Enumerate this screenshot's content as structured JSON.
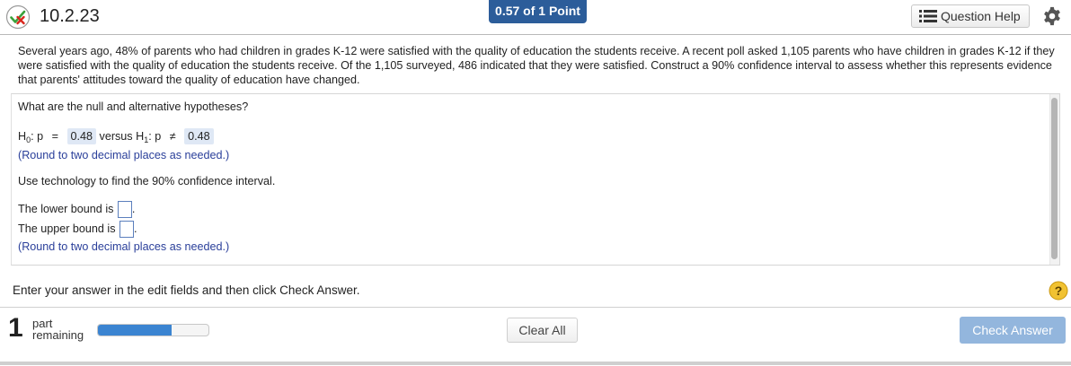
{
  "header": {
    "question_number": "10.2.23",
    "points": "0.57 of 1 Point",
    "question_help_label": "Question Help"
  },
  "problem": {
    "text": "Several years ago, 48% of parents who had children in grades K-12 were satisfied with the quality of education the students receive. A recent poll asked 1,105 parents who have children in grades K-12 if they were satisfied with the quality of education the students receive. Of the 1,105 surveyed, 486 indicated that they were satisfied. Construct a 90% confidence interval to assess whether this represents evidence that parents' attitudes toward the quality of education have changed."
  },
  "work": {
    "prompt_hypotheses": "What are the null and alternative hypotheses?",
    "h0_label": "H",
    "h0_sub": "0",
    "h0_var": ": p",
    "h0_op": "=",
    "h0_value": "0.48",
    "versus": "versus",
    "h1_label": "H",
    "h1_sub": "1",
    "h1_var": ": p",
    "h1_op": "≠",
    "h1_value": "0.48",
    "round_note_1": "(Round to two decimal places as needed.)",
    "prompt_interval": "Use technology to find the 90% confidence interval.",
    "lower_label": "The lower bound is",
    "upper_label": "The upper bound is",
    "period": ".",
    "round_note_2": "(Round to two decimal places as needed.)"
  },
  "footer": {
    "instruction": "Enter your answer in the edit fields and then click Check Answer.",
    "parts_remaining_count": "1",
    "part_word": "part",
    "remaining_word": "remaining",
    "progress_fraction": 0.67,
    "clear_all_label": "Clear All",
    "check_answer_label": "Check Answer"
  },
  "colors": {
    "points_badge": "#2c5d9a",
    "check_button": "#93b6dd",
    "progress_fill": "#3b84d1",
    "hint_text": "#2a3f9a"
  },
  "icons": [
    "partial-credit-icon",
    "list-icon",
    "gear-icon",
    "help-icon"
  ]
}
